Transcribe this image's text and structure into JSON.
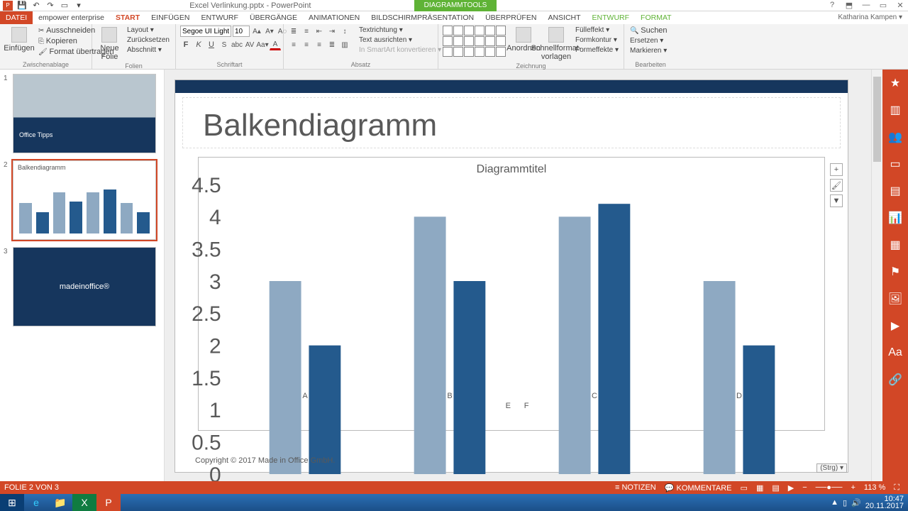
{
  "titlebar": {
    "doc": "Excel Verlinkung.pptx - PowerPoint",
    "tooltab": "DIAGRAMMTOOLS"
  },
  "win": {
    "help": "?",
    "min": "—",
    "max": "▭",
    "close": "✕"
  },
  "tabs": {
    "file": "DATEI",
    "empower": "empower enterprise",
    "start": "START",
    "einfuegen": "EINFÜGEN",
    "entwurf": "ENTWURF",
    "uebergaenge": "ÜBERGÄNGE",
    "animationen": "ANIMATIONEN",
    "praesentation": "BILDSCHIRMPRÄSENTATION",
    "ueberpruefen": "ÜBERPRÜFEN",
    "ansicht": "ANSICHT",
    "ctx_entwurf": "ENTWURF",
    "ctx_format": "FORMAT"
  },
  "user": "Katharina Kampen ▾",
  "ribbon": {
    "g1": {
      "label": "Zwischenablage",
      "paste": "Einfügen",
      "cut": "Ausschneiden",
      "copy": "Kopieren",
      "format": "Format übertragen"
    },
    "g2": {
      "label": "Folien",
      "new": "Neue\nFolie",
      "layout": "Layout ▾",
      "reset": "Zurücksetzen",
      "section": "Abschnitt ▾"
    },
    "g3": {
      "label": "Schriftart",
      "font": "Segoe UI Light (",
      "size": "10"
    },
    "g4": {
      "label": "Absatz",
      "dir": "Textrichtung ▾",
      "align": "Text ausrichten ▾",
      "smart": "In SmartArt konvertieren ▾"
    },
    "g5": {
      "label": "Zeichnung",
      "arrange": "Anordnen",
      "quick": "Schnellformat-\nvorlagen",
      "fill": "Fülleffekt ▾",
      "outline": "Formkontur ▾",
      "effects": "Formeffekte ▾"
    },
    "g6": {
      "label": "Bearbeiten",
      "find": "Suchen",
      "replace": "Ersetzen ▾",
      "select": "Markieren ▾"
    }
  },
  "thumbs": {
    "t1": "Office Tipps",
    "t2": "Balkendiagramm",
    "t3": "madeinoffice"
  },
  "slide": {
    "title": "Balkendiagramm",
    "copyright": "Copyright © 2017 Made in Office GmbH.",
    "strg": "(Strg) ▾"
  },
  "chart_data": {
    "type": "bar",
    "title": "Diagrammtitel",
    "categories": [
      "A",
      "B",
      "C",
      "D"
    ],
    "series": [
      {
        "name": "E",
        "values": [
          3,
          4,
          4,
          3
        ]
      },
      {
        "name": "F",
        "values": [
          2,
          3,
          4.2,
          2
        ]
      }
    ],
    "ylim": [
      0,
      4.5
    ],
    "ystep": 0.5,
    "colors": {
      "E": "#8ea9c2",
      "F": "#245a8d"
    }
  },
  "status": {
    "slide": "FOLIE 2 VON 3",
    "notes": "NOTIZEN",
    "comments": "KOMMENTARE",
    "zoom": "113 %"
  },
  "task": {
    "time": "10:47",
    "date": "20.11.2017"
  }
}
